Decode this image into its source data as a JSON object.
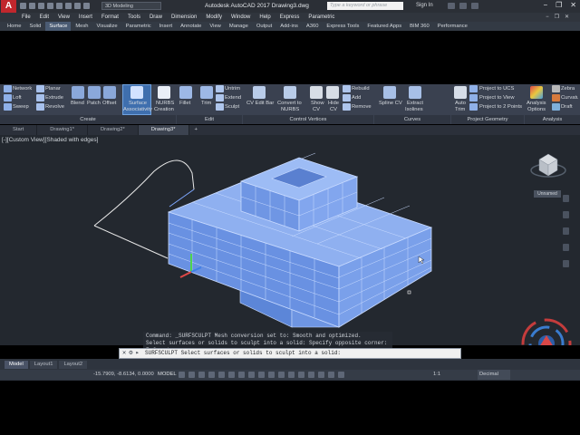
{
  "app": {
    "logo": "A",
    "workspace": "3D Modeling",
    "title": "Autodesk AutoCAD 2017   Drawing3.dwg",
    "search_placeholder": "Type a keyword or phrase",
    "signin": "Sign In"
  },
  "menu": [
    "File",
    "Edit",
    "View",
    "Insert",
    "Format",
    "Tools",
    "Draw",
    "Dimension",
    "Modify",
    "Window",
    "Help",
    "Express",
    "Parametric"
  ],
  "ribbon_tabs": [
    "Home",
    "Solid",
    "Surface",
    "Mesh",
    "Visualize",
    "Parametric",
    "Insert",
    "Annotate",
    "View",
    "Manage",
    "Output",
    "Add-ins",
    "A360",
    "Express Tools",
    "Featured Apps",
    "BIM 360",
    "Performance"
  ],
  "ribbon_active_tab": "Surface",
  "ribbon": {
    "create": {
      "network": "Network",
      "loft": "Loft",
      "sweep": "Sweep",
      "planar": "Planar",
      "extrude": "Extrude",
      "revolve": "Revolve",
      "blend": "Blend",
      "patch": "Patch",
      "offset": "Offset",
      "surface_assoc_1": "Surface",
      "surface_assoc_2": "Associativity",
      "nurbs_1": "NURBS",
      "nurbs_2": "Creation",
      "group": "Create"
    },
    "edit": {
      "fillet": "Fillet",
      "trim": "Trim",
      "untrim": "Untrim",
      "extend": "Extend",
      "sculpt": "Sculpt",
      "group": "Edit"
    },
    "cv": {
      "cv_edit_bar": "CV Edit Bar",
      "convert_1": "Convert to",
      "convert_2": "NURBS",
      "show_1": "Show",
      "show_2": "CV",
      "hide_1": "Hide",
      "hide_2": "CV",
      "rebuild": "Rebuild",
      "add": "Add",
      "remove": "Remove",
      "group": "Control Vertices"
    },
    "curves": {
      "spline_cv": "Spline CV",
      "extract_1": "Extract",
      "extract_2": "Isolines",
      "group": "Curves"
    },
    "project": {
      "auto_1": "Auto",
      "auto_2": "Trim",
      "to_ucs": "Project to UCS",
      "to_view": "Project to View",
      "to_2points": "Project to 2 Points",
      "group": "Project Geometry"
    },
    "analysis": {
      "zebra": "Zebra",
      "curvature": "Curvature",
      "draft": "Draft",
      "options_1": "Analysis",
      "options_2": "Options",
      "group": "Analysis"
    }
  },
  "doc_tabs": [
    "Start",
    "Drawing1*",
    "Drawing2*",
    "Drawing3*"
  ],
  "doc_tab_active": "Drawing3*",
  "viewport": {
    "label": "[-][Custom View][Shaded with edges]",
    "viewcube_label": "Unnamed"
  },
  "command": {
    "history_1": "Command: _SURFSCULPT Mesh conversion set to: Smooth and optimized.",
    "history_2": "Select surfaces or solids to sculpt into a solid: Specify opposite corner: 7 found",
    "prompt": "SURFSCULPT Select surfaces or solids to sculpt into a solid:"
  },
  "layout_tabs": [
    "Model",
    "Layout1",
    "Layout2"
  ],
  "layout_active": "Model",
  "status": {
    "coords": "-15.7909, -8.6134, 0.0000",
    "model": "MODEL",
    "scale": "1:1",
    "units": "Decimal"
  },
  "colors": {
    "viewport_bg": "#23282f",
    "model_face": "#6d93e0",
    "model_edge": "#c9dbff",
    "ribbon_bg": "#3a4150",
    "accent": "#3f6fae"
  }
}
